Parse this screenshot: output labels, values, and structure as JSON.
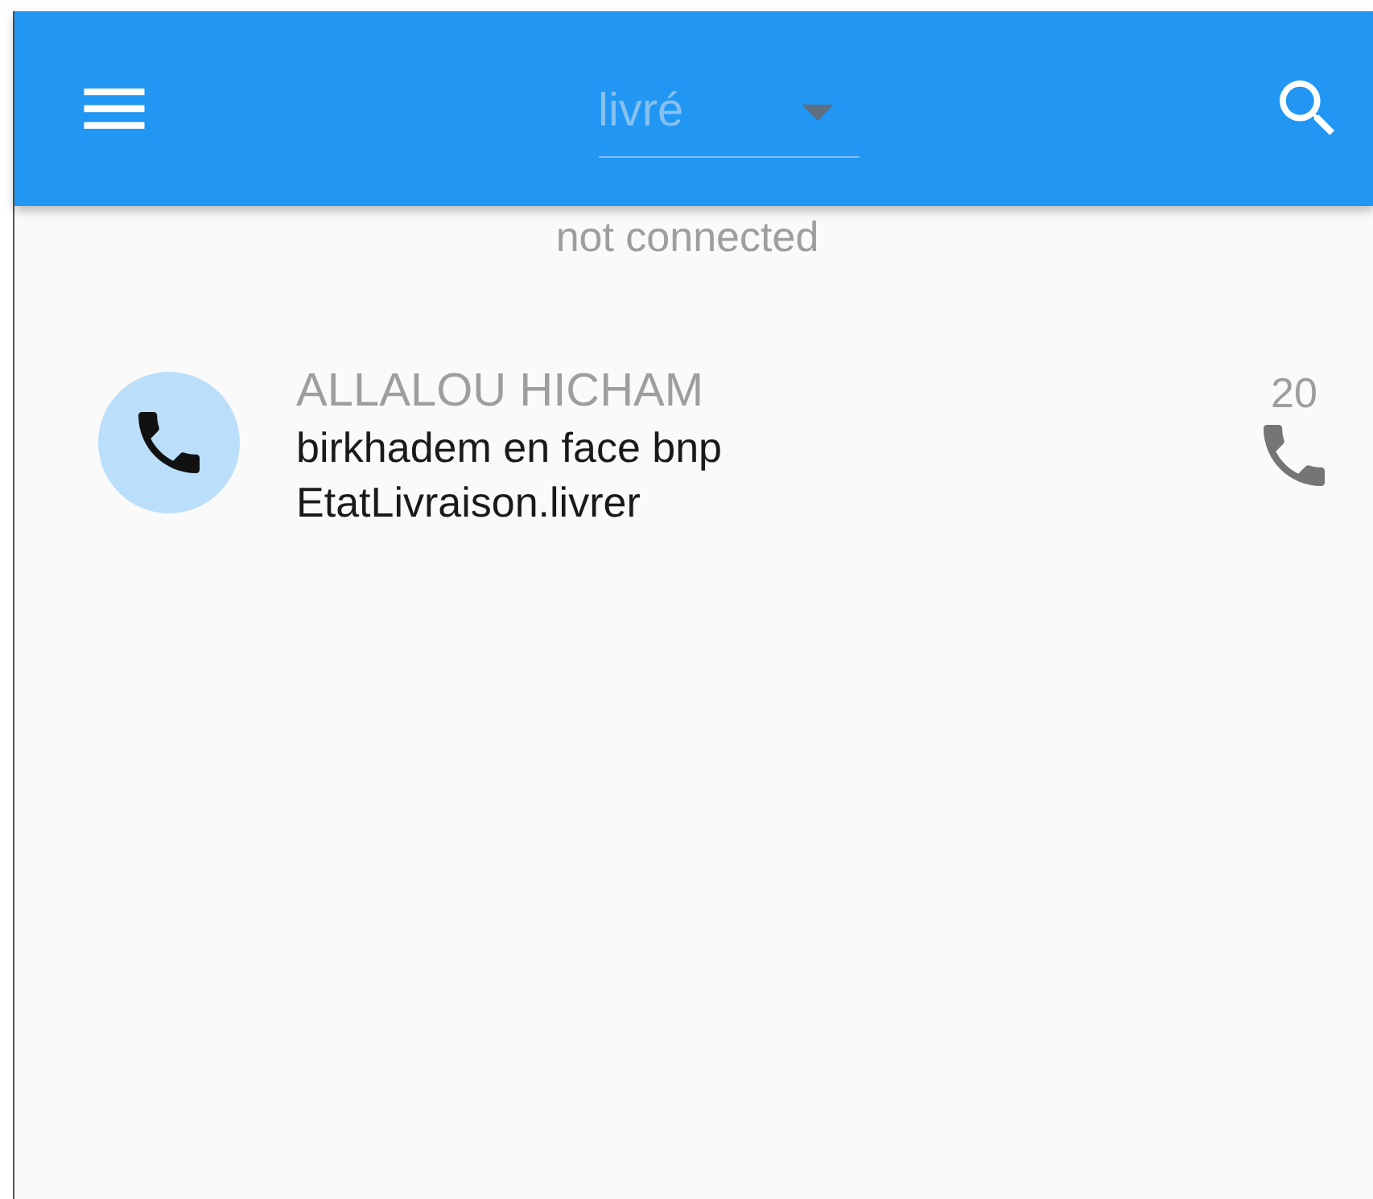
{
  "app_bar": {
    "filter_dropdown": {
      "value": "livré"
    }
  },
  "connection_status": "not connected",
  "deliveries": [
    {
      "name": "ALLALOU HICHAM",
      "address": "birkhadem en face bnp",
      "status": "EtatLivraison.livrer",
      "count": "20"
    }
  ]
}
